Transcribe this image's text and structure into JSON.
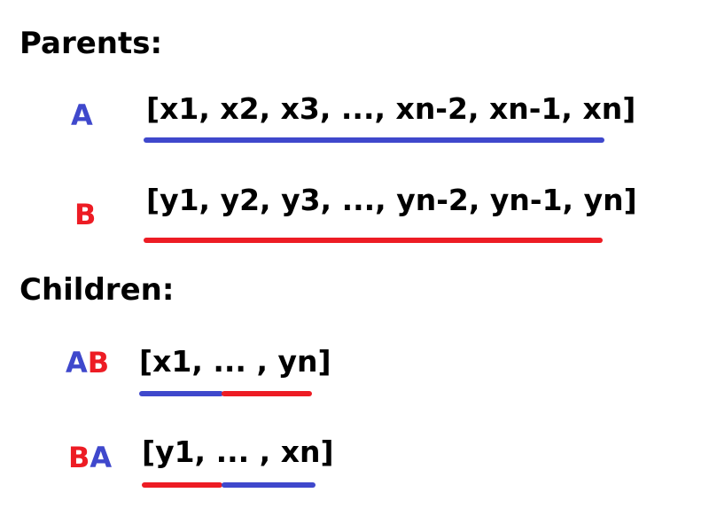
{
  "colors": {
    "blue": "#3f48cc",
    "red": "#ed1c24",
    "text": "#000000"
  },
  "parents": {
    "heading": "Parents:",
    "a": {
      "label": "A",
      "sequence": "[x1, x2, x3, ..., xn-2, xn-1, xn]",
      "underline_color": "blue"
    },
    "b": {
      "label": "B",
      "sequence": "[y1, y2, y3, ..., yn-2, yn-1, yn]",
      "underline_color": "red"
    }
  },
  "children": {
    "heading": "Children:",
    "ab": {
      "label_parts": [
        "A",
        "B"
      ],
      "sequence": "[x1, ... , yn]",
      "underline_segments": [
        "blue",
        "red"
      ]
    },
    "ba": {
      "label_parts": [
        "B",
        "A"
      ],
      "sequence": "[y1, ... , xn]",
      "underline_segments": [
        "red",
        "blue"
      ]
    }
  }
}
